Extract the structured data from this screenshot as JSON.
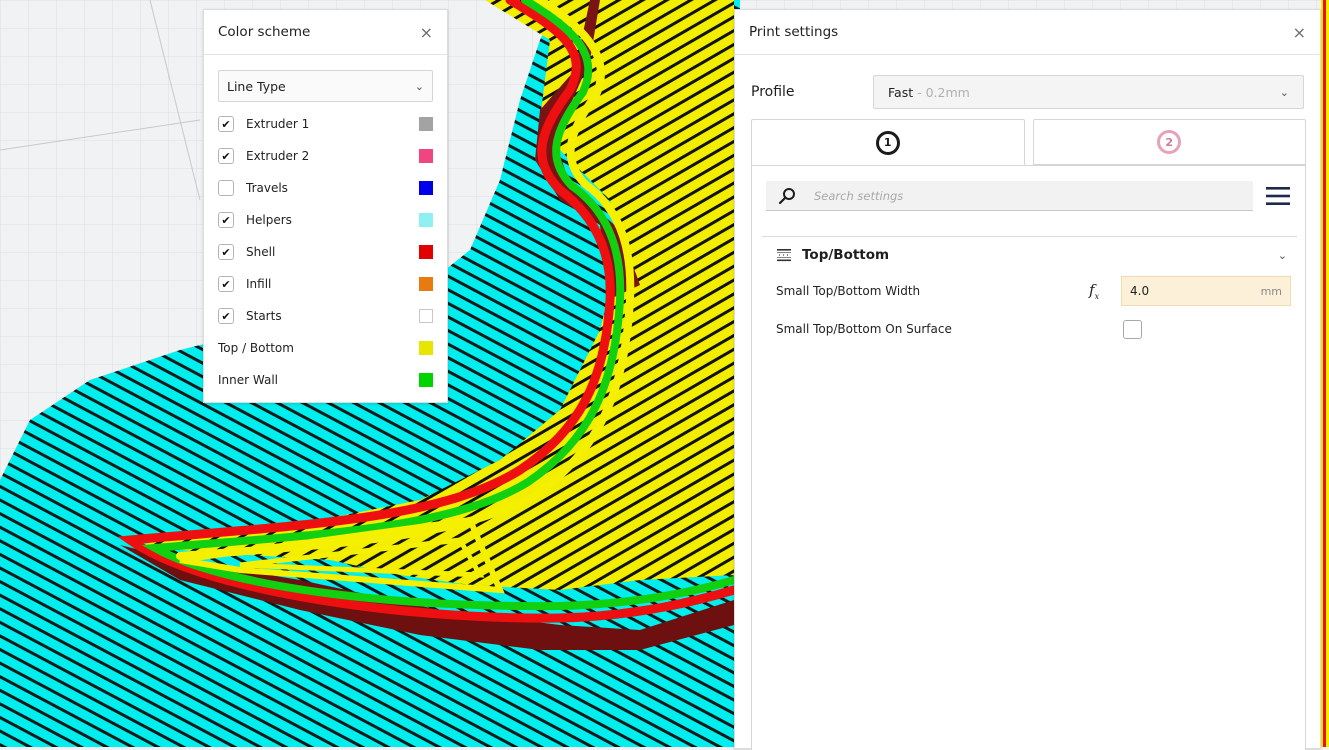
{
  "color_scheme": {
    "title": "Color scheme",
    "close_glyph": "×",
    "view_mode": "Line Type",
    "items": [
      {
        "label": "Extruder 1",
        "checkbox": true,
        "checked": true,
        "color": "#a3a3a3"
      },
      {
        "label": "Extruder 2",
        "checkbox": true,
        "checked": true,
        "color": "#f0457f"
      },
      {
        "label": "Travels",
        "checkbox": true,
        "checked": false,
        "color": "#0000e8"
      },
      {
        "label": "Helpers",
        "checkbox": true,
        "checked": true,
        "color": "#8ef0f0"
      },
      {
        "label": "Shell",
        "checkbox": true,
        "checked": true,
        "color": "#e00000"
      },
      {
        "label": "Infill",
        "checkbox": true,
        "checked": true,
        "color": "#e77a10"
      },
      {
        "label": "Starts",
        "checkbox": true,
        "checked": true,
        "color": "#ffffff"
      },
      {
        "label": "Top / Bottom",
        "checkbox": false,
        "color": "#e6e600"
      },
      {
        "label": "Inner Wall",
        "checkbox": false,
        "color": "#00d400"
      }
    ]
  },
  "print_settings": {
    "title": "Print settings",
    "close_glyph": "×",
    "profile_label": "Profile",
    "profile_name": "Fast",
    "profile_detail": "- 0.2mm",
    "tabs": [
      {
        "badge": "1",
        "active": true
      },
      {
        "badge": "2",
        "active": false
      }
    ],
    "search_placeholder": "Search settings",
    "category": "Top/Bottom",
    "settings": [
      {
        "label": "Small Top/Bottom Width",
        "value": "4.0",
        "unit": "mm"
      },
      {
        "label": "Small Top/Bottom On Surface",
        "checked": false
      }
    ]
  },
  "colors": {
    "helpers_cyan": "#00f0f0",
    "top_bottom_yellow": "#f5f000",
    "shell_red": "#ee1010",
    "inner_wall_green": "#10d010",
    "wall_dark_red": "#7a1010",
    "grid_bg": "#f1f2f4"
  }
}
